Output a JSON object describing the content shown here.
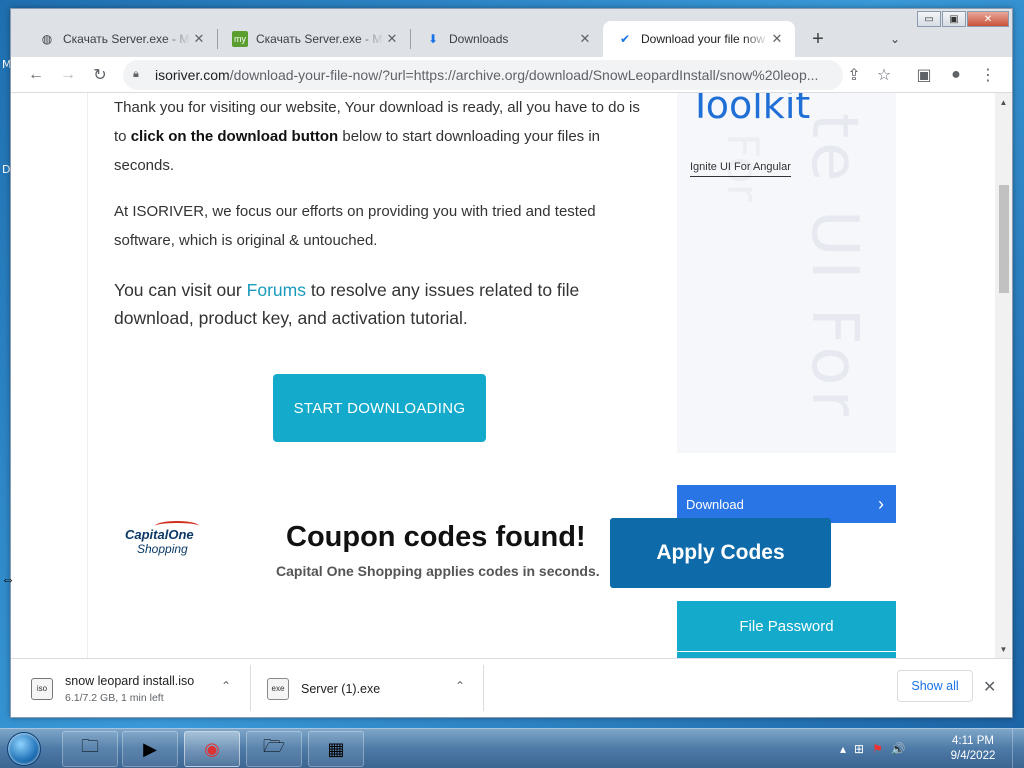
{
  "desktop": {
    "glyph_1": "M",
    "glyph_2": "D"
  },
  "window_controls": {
    "minimize": "▭",
    "maximize": "▣",
    "close": "✕"
  },
  "tabs": [
    {
      "title": "Скачать Server.exe - My",
      "icon": "globe-icon",
      "fav": "◍"
    },
    {
      "title": "Скачать Server.exe - My",
      "icon": "my-icon",
      "fav": "my"
    },
    {
      "title": "Downloads",
      "icon": "download-icon",
      "fav": "⬇"
    },
    {
      "title": "Download your file now",
      "icon": "check-icon",
      "fav": "✔"
    }
  ],
  "tab_close": "✕",
  "new_tab": "+",
  "tab_search": "⌄",
  "toolbar": {
    "back": "←",
    "forward": "→",
    "reload": "↻",
    "url_host": "isoriver.com",
    "url_path": "/download-your-file-now/?url=https://archive.org/download/SnowLeopardInstall/snow%20leop...",
    "share": "⇪",
    "star": "☆",
    "sidepanel": "▣",
    "profile": "●",
    "menu": "⋮"
  },
  "content": {
    "p1_a": "Thank you for visiting our website, Your download is ready, all you have to do is to ",
    "p1_bold": "click on the download button",
    "p1_b": " below to start downloading your files in seconds.",
    "p2": "At ISORIVER, we focus our efforts on providing you with tried and tested software, which is original & untouched.",
    "p3_a": "You can visit our ",
    "p3_link": "Forums",
    "p3_b": " to resolve any issues related to file download, product key, and activation tutorial.",
    "start_button": "START DOWNLOADING"
  },
  "sidebar_ad": {
    "title": "Toolkit",
    "ignite": "Ignite UI For Angular",
    "ghost_text": "te UI For",
    "ghost_text_2": "For",
    "download_label": "Download",
    "download_chevron": "›"
  },
  "coupon_ad": {
    "brand": "CapitalOne",
    "brand_sub": "Shopping",
    "title": "Coupon codes found!",
    "subtitle": "Capital One Shopping applies codes in seconds.",
    "apply_button": "Apply Codes"
  },
  "file_password": "File Password",
  "downloads": [
    {
      "name": "snow leopard install.iso",
      "status": "6.1/7.2 GB, 1 min left",
      "icon": "iso",
      "chevron": "⌃"
    },
    {
      "name": "Server (1).exe",
      "status": "",
      "icon": "exe",
      "chevron": "⌃"
    }
  ],
  "show_all": "Show all",
  "shelf_close": "✕",
  "scroll": {
    "up": "▲",
    "down": "▼"
  },
  "taskbar": {
    "apps": [
      {
        "name": "explorer",
        "glyph": "🗀"
      },
      {
        "name": "media-player",
        "glyph": "▶"
      },
      {
        "name": "chrome",
        "glyph": "◉"
      },
      {
        "name": "folder",
        "glyph": "🗁"
      },
      {
        "name": "control-panel",
        "glyph": "▦"
      }
    ],
    "tray": {
      "arrow": "▴",
      "network": "⊞",
      "flag": "⚑",
      "volume": "🔊"
    },
    "time": "4:11 PM",
    "date": "9/4/2022"
  },
  "cursor": "⇔"
}
